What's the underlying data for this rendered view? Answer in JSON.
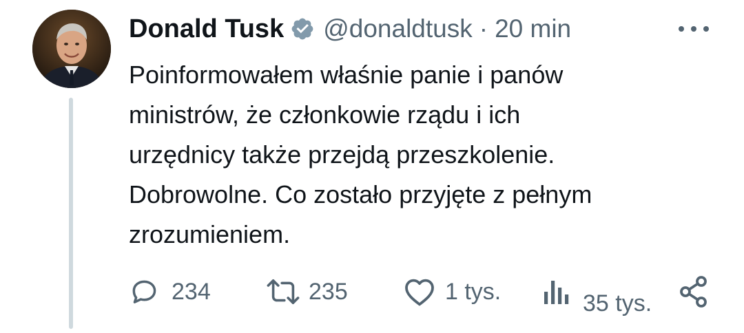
{
  "author": {
    "name": "Donald Tusk",
    "handle": "@donaldtusk",
    "separator": "·",
    "time": "20 min",
    "verified": true,
    "verified_color": "#829aab"
  },
  "tweet": {
    "lines": [
      "Poinformowałem właśnie panie i panów",
      "ministrów, że członkowie rządu i ich",
      "urzędnicy także przejdą przeszkolenie.",
      "Dobrowolne. Co zostało przyjęte z pełnym",
      "zrozumieniem."
    ]
  },
  "actions": {
    "reply_count": "234",
    "retweet_count": "235",
    "like_count": "1 tys.",
    "views_count": "35 tys."
  },
  "icons": {
    "avatar": "avatar",
    "verified": "verified-badge-icon",
    "more": "more-icon",
    "reply": "reply-icon",
    "retweet": "retweet-icon",
    "like": "heart-icon",
    "views": "views-icon",
    "share": "share-icon"
  },
  "colors": {
    "text": "#0f1419",
    "muted": "#536471",
    "thread_line": "#cfd9de"
  }
}
